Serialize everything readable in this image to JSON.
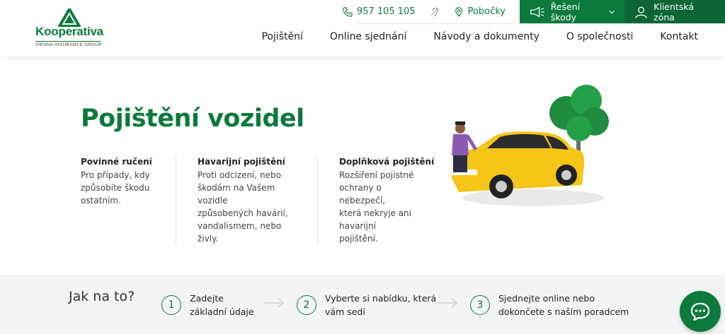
{
  "brand": {
    "name": "Kooperativa",
    "tagline": "VIENNA INSURANCE GROUP"
  },
  "topbar": {
    "phone": "957 105 105",
    "branches": "Pobočky",
    "damage_button": "Řešení škody",
    "client_button": "Klientská zóna"
  },
  "nav": {
    "items": [
      "Pojištění",
      "Online sjednání",
      "Návody a dokumenty",
      "O společnosti",
      "Kontakt"
    ]
  },
  "hero": {
    "title": "Pojištění vozidel",
    "columns": [
      {
        "title": "Povinné ručení",
        "lines": [
          "Pro případy, kdy",
          "způsobíte škodu",
          "ostatním."
        ]
      },
      {
        "title": "Havarijní pojištění",
        "lines": [
          "Proti odcizení, nebo",
          "škodám na Vašem vozidle",
          "způsobených havárií,",
          "vandalismem, nebo živly."
        ]
      },
      {
        "title": "Doplňková pojištění",
        "lines": [
          "Rozšíření pojistné",
          "ochrany o nebezpečí,",
          "která nekryje ani havarijní",
          "pojištění."
        ]
      }
    ]
  },
  "steps": {
    "heading": "Jak na to?",
    "items": [
      {
        "num": "1",
        "line1": "Zadejte",
        "line2": "základní údaje"
      },
      {
        "num": "2",
        "line1": "Vyberte si nabídku, která",
        "line2": "vám sedí"
      },
      {
        "num": "3",
        "line1": "Sjednejte online nebo",
        "line2": "dokončete s naším poradcem"
      }
    ]
  },
  "colors": {
    "brand_green": "#0b7a3c",
    "brand_green_dark": "#0b6534",
    "band_bg": "#f4f4f4"
  }
}
